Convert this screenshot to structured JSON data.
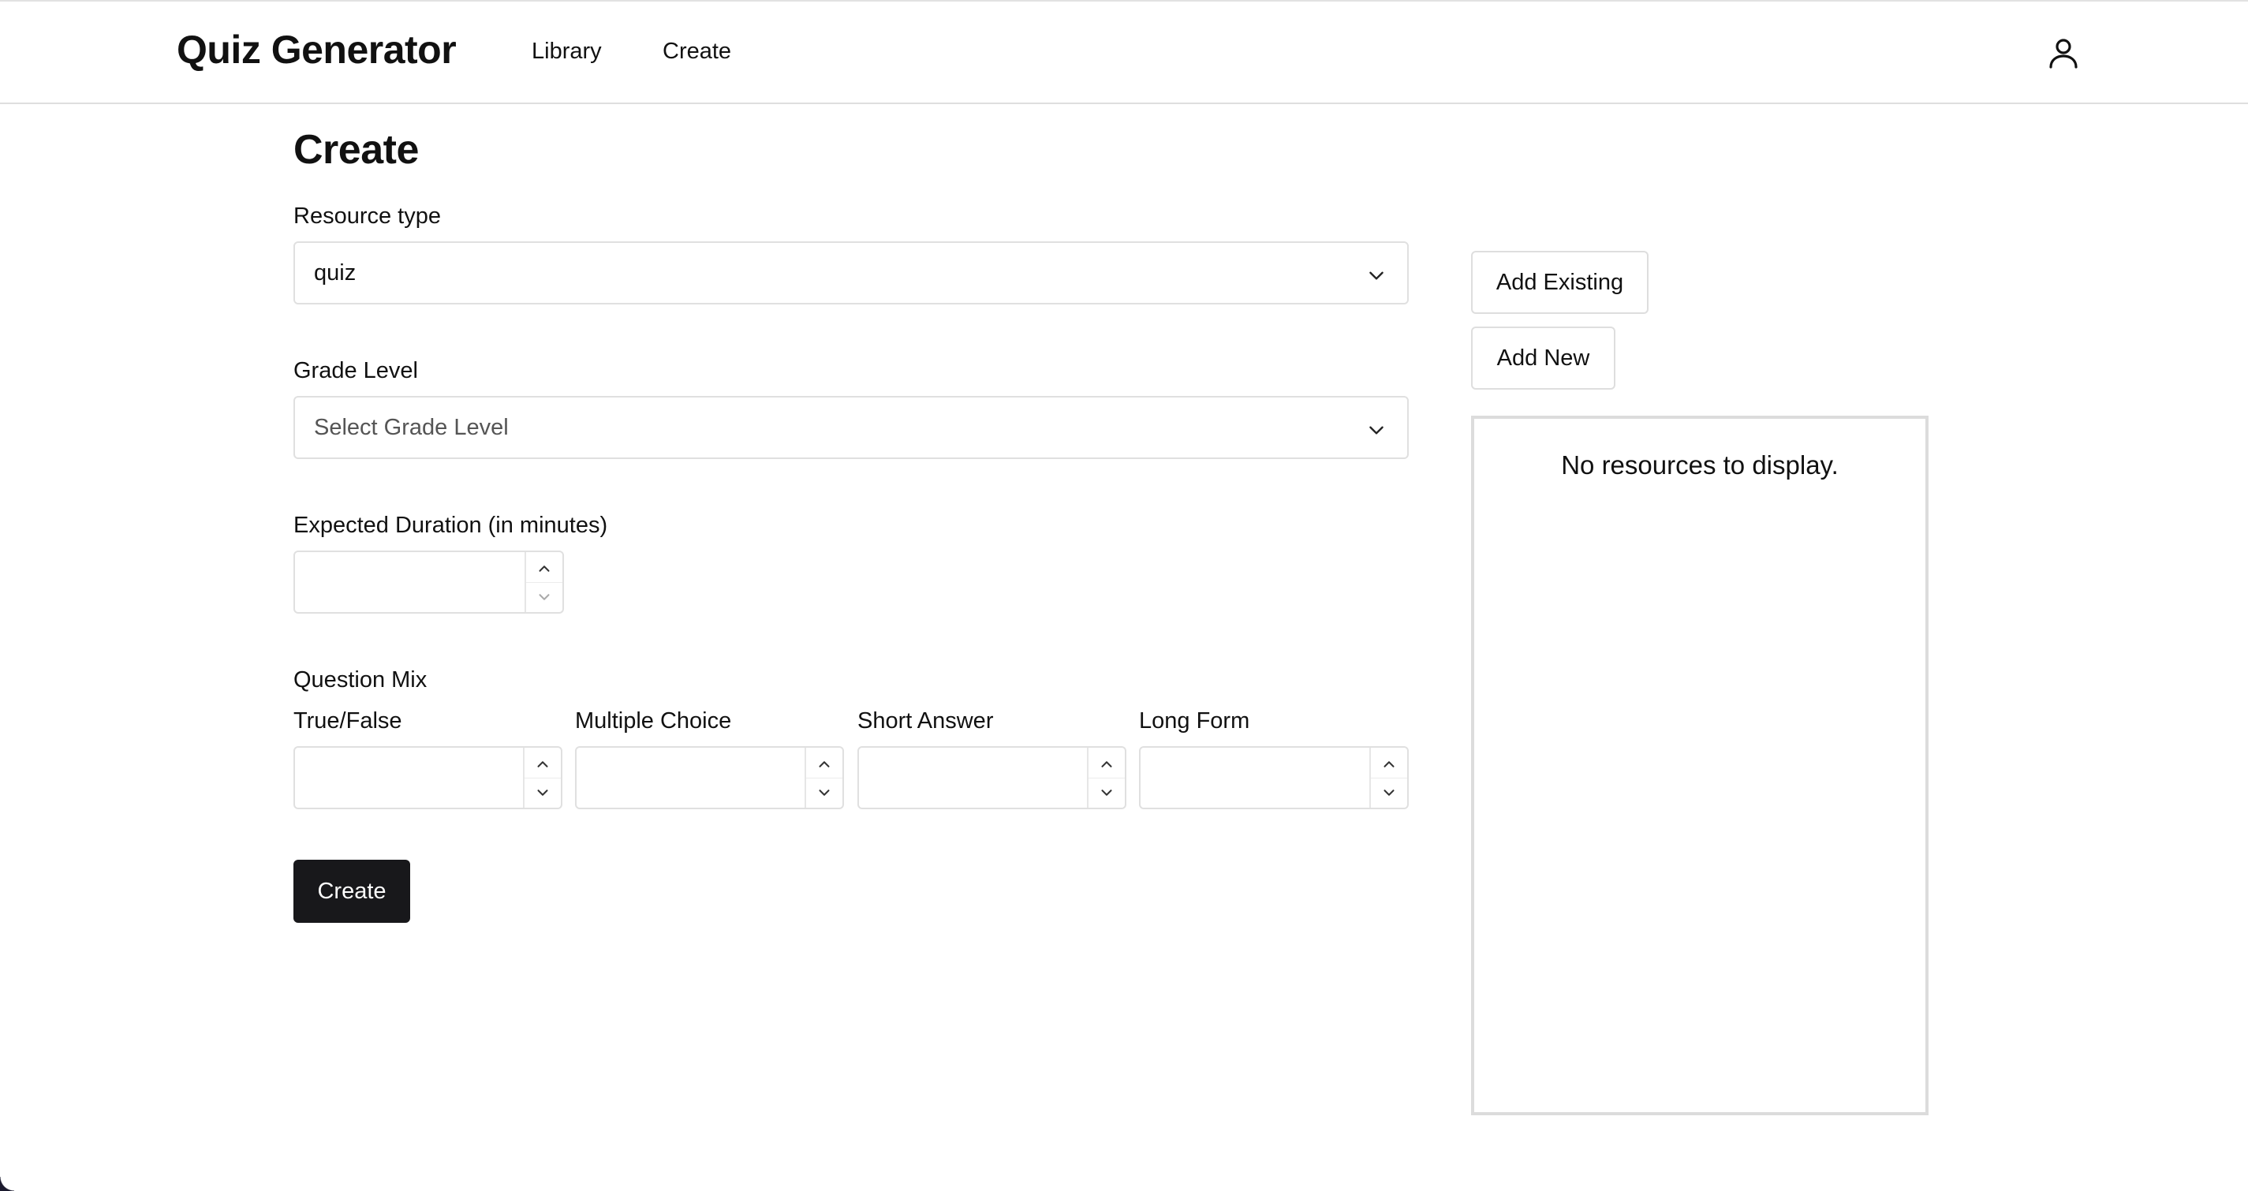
{
  "header": {
    "brand": "Quiz Generator",
    "nav": {
      "library": "Library",
      "create": "Create"
    },
    "user_icon": "user-icon"
  },
  "page": {
    "title": "Create"
  },
  "form": {
    "resource_type": {
      "label": "Resource type",
      "value": "quiz"
    },
    "grade_level": {
      "label": "Grade Level",
      "placeholder": "Select Grade Level"
    },
    "duration": {
      "label": "Expected Duration (in minutes)",
      "value": ""
    },
    "question_mix": {
      "label": "Question Mix",
      "fields": {
        "true_false": {
          "label": "True/False",
          "value": ""
        },
        "multiple_choice": {
          "label": "Multiple Choice",
          "value": ""
        },
        "short_answer": {
          "label": "Short Answer",
          "value": ""
        },
        "long_form": {
          "label": "Long Form",
          "value": ""
        }
      }
    },
    "submit_label": "Create"
  },
  "resources": {
    "add_existing_label": "Add Existing",
    "add_new_label": "Add New",
    "empty_text": "No resources to display."
  }
}
